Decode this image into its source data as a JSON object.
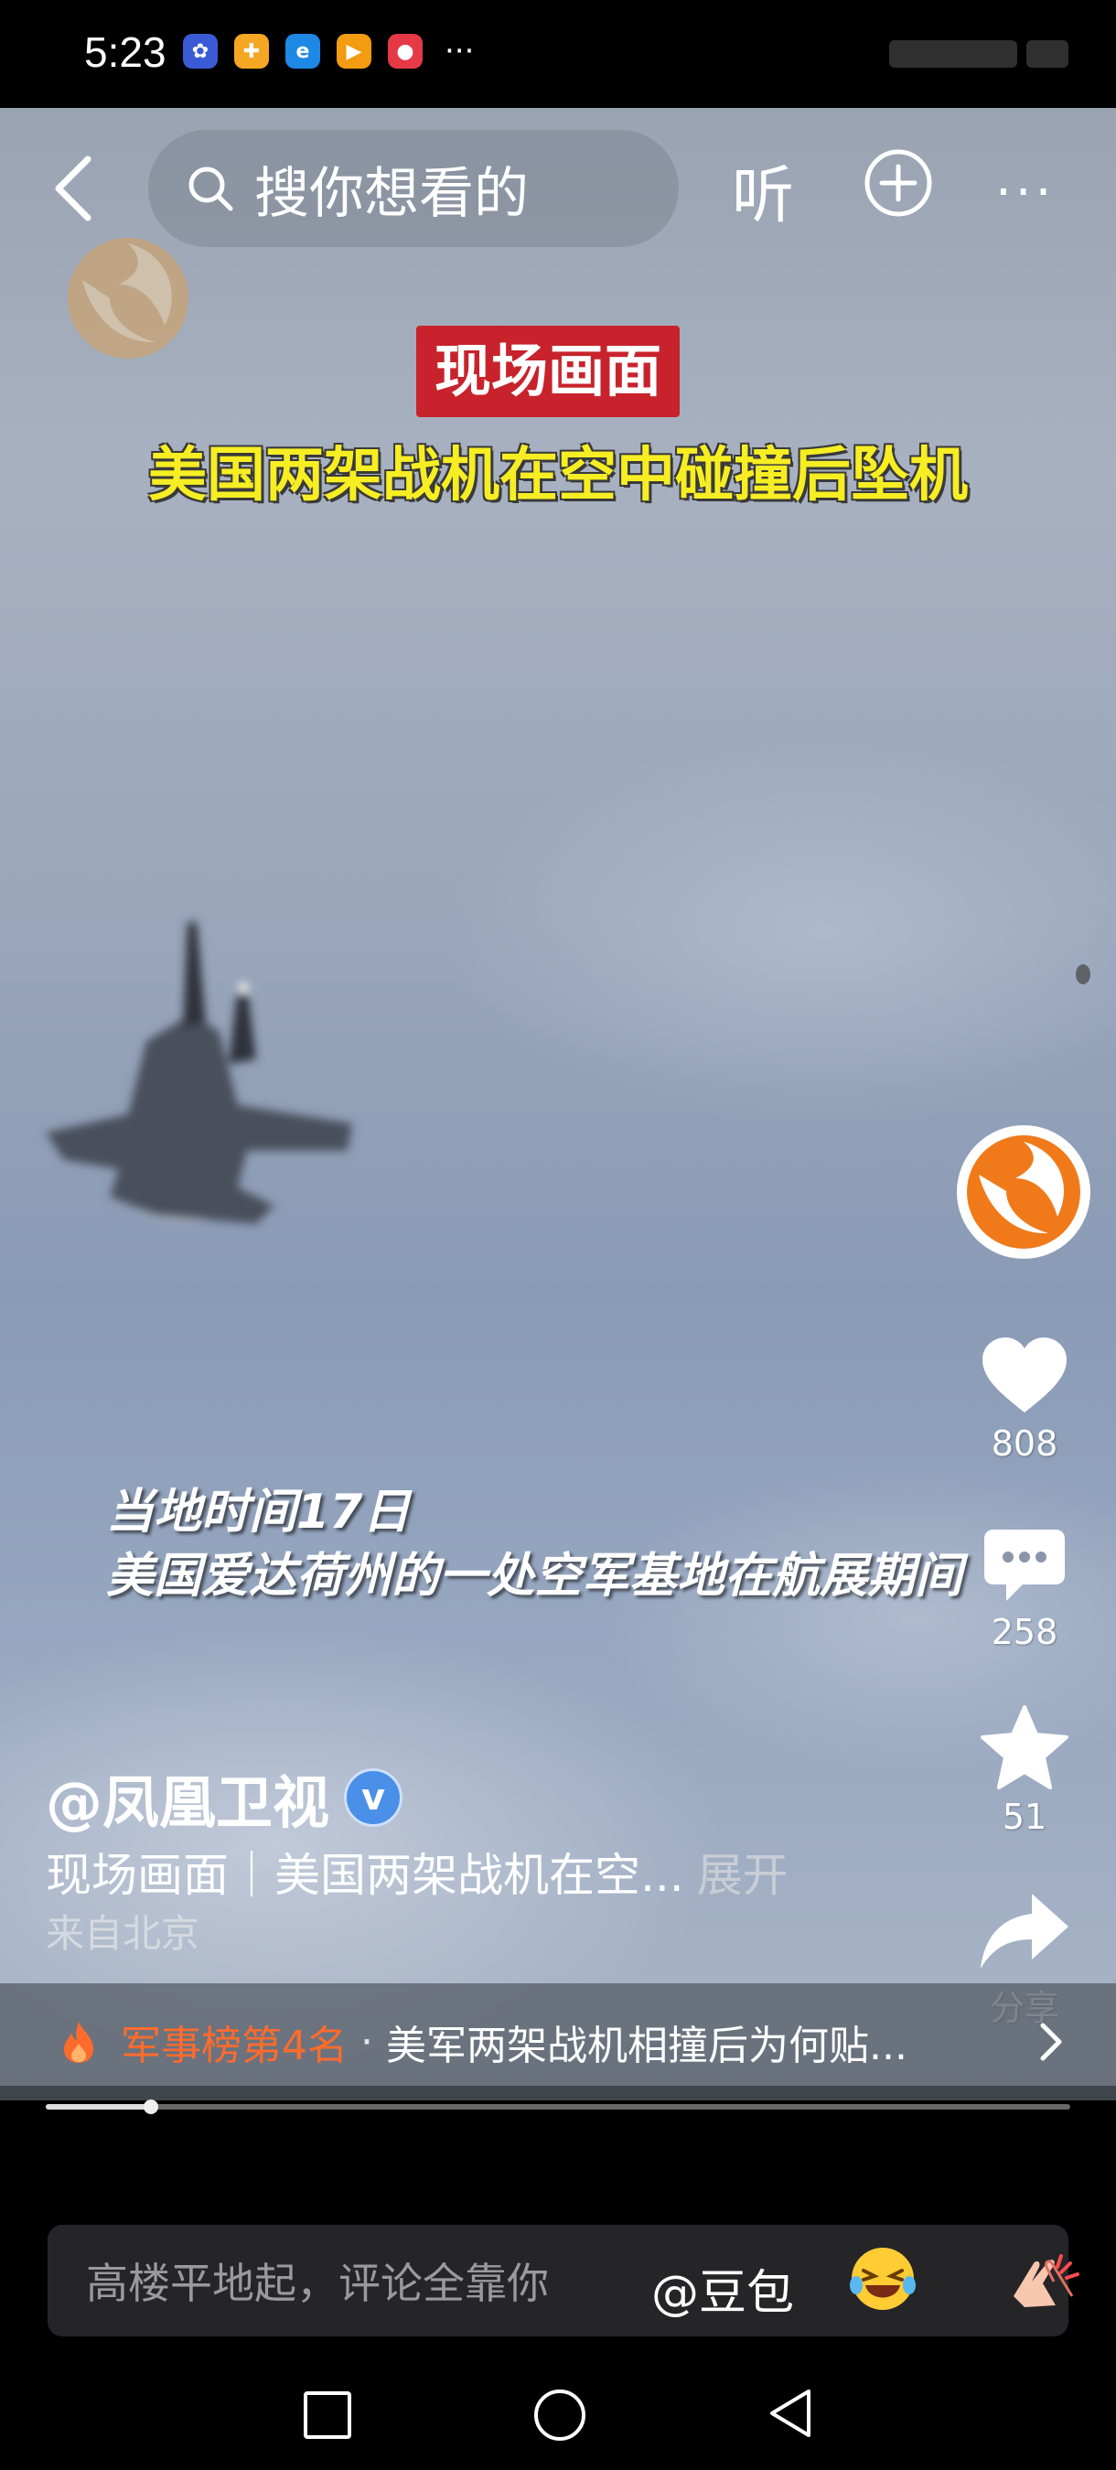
{
  "status_bar": {
    "time": "5:23",
    "more": "···",
    "apps": [
      {
        "name": "app-1",
        "color": "#3b5bd6",
        "glyph": "✿"
      },
      {
        "name": "app-2",
        "color": "#f5a623",
        "glyph": "✚"
      },
      {
        "name": "app-3",
        "color": "#1e88e5",
        "glyph": "e"
      },
      {
        "name": "app-4",
        "color": "#f39c12",
        "glyph": "▶"
      },
      {
        "name": "app-5",
        "color": "#e63946",
        "glyph": "●"
      }
    ]
  },
  "top_nav": {
    "search_placeholder": "搜你想看的",
    "listen_label": "听",
    "more_label": "···"
  },
  "video": {
    "tag": "现场画面",
    "headline": "美国两架战机在空中碰撞后坠机",
    "subtitle_line1": "当地时间17日",
    "subtitle_line2": "美国爱达荷州的一处空军基地在航展期间"
  },
  "rail": {
    "likes": "808",
    "comments": "258",
    "favorites": "51",
    "share_label": "分享"
  },
  "info": {
    "author": "@凤凰卫视",
    "verified_mark": "v",
    "description": "现场画面｜美国两架战机在空...",
    "expand_label": "展开",
    "location": "来自北京"
  },
  "trending": {
    "rank": "军事榜第4名",
    "separator": "·",
    "text": "美军两架战机相撞后为何贴..."
  },
  "progress": {
    "fraction": 0.103
  },
  "comment_bar": {
    "placeholder": "高楼平地起，评论全靠你",
    "mention": "@豆包"
  },
  "colors": {
    "accent_red": "#c8232c",
    "headline_yellow": "#f6ee23",
    "trend_orange": "#ff6b2c",
    "phoenix_orange": "#f07a1a"
  }
}
